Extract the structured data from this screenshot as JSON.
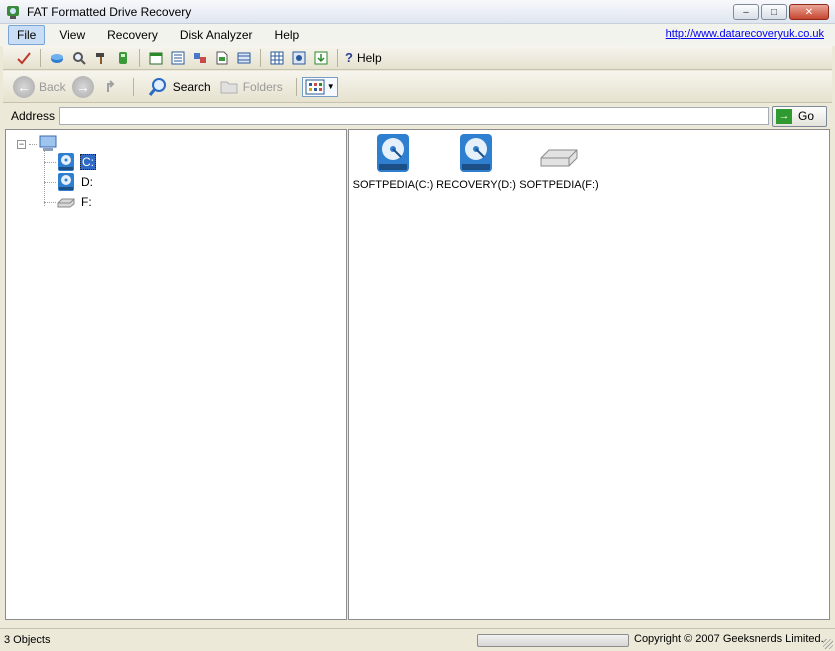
{
  "window": {
    "title": "FAT Formatted Drive Recovery",
    "controls": {
      "minimize": "–",
      "maximize": "□",
      "close": "✕"
    }
  },
  "menu": {
    "items": [
      {
        "label": "File",
        "active": true
      },
      {
        "label": "View",
        "active": false
      },
      {
        "label": "Recovery",
        "active": false
      },
      {
        "label": "Disk Analyzer",
        "active": false
      },
      {
        "label": "Help",
        "active": false
      }
    ],
    "link": "http://www.datarecoveryuk.co.uk"
  },
  "toolbar": {
    "icons": [
      "checkmark-icon",
      "recover-icon",
      "search-files-icon",
      "hammer-icon",
      "save-icon",
      "calendar-icon",
      "list-icon",
      "properties-icon",
      "document-icon",
      "filmstrip-icon",
      "grid-icon",
      "disk-icon",
      "export-icon"
    ],
    "help_label": "Help"
  },
  "navbar": {
    "back_label": "Back",
    "search_label": "Search",
    "folders_label": "Folders"
  },
  "address": {
    "label": "Address",
    "value": "",
    "go_label": "Go"
  },
  "tree": {
    "root_expander": "−",
    "drives": [
      {
        "label": "C:",
        "type": "hard-drive",
        "selected": true
      },
      {
        "label": "D:",
        "type": "hard-drive",
        "selected": false
      },
      {
        "label": "F:",
        "type": "removable",
        "selected": false
      }
    ]
  },
  "files": [
    {
      "label": "SOFTPEDIA(C:)",
      "type": "hard-drive"
    },
    {
      "label": "RECOVERY(D:)",
      "type": "hard-drive"
    },
    {
      "label": "SOFTPEDIA(F:)",
      "type": "removable"
    }
  ],
  "status": {
    "objects": "3 Objects",
    "progress": 0,
    "copyright": "Copyright © 2007 Geeksnerds Limited."
  },
  "colors": {
    "accent": "#316ac5",
    "drive_blue": "#2f7fd0",
    "go_green": "#2f9a2f",
    "link": "#0000ee"
  }
}
